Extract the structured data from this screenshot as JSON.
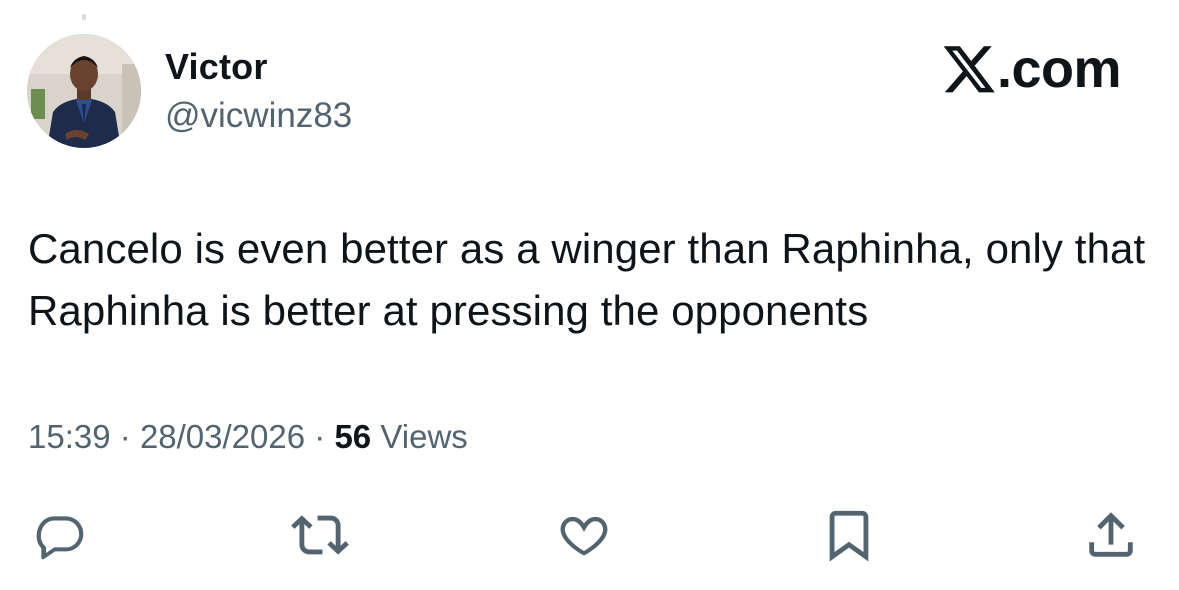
{
  "author": {
    "display_name": "Victor",
    "handle": "@vicwinz83"
  },
  "brand": {
    "text": ".com",
    "logo_icon": "x-logo-icon"
  },
  "tweet": {
    "text": "Cancelo is even better as a winger than Raphinha, only that Raphinha is better at pressing the opponents",
    "time": "15:39",
    "separator": "·",
    "date": "28/03/2026",
    "view_count": "56",
    "views_label": "Views"
  },
  "actions": [
    {
      "name": "reply",
      "icon": "reply-icon"
    },
    {
      "name": "retweet",
      "icon": "retweet-icon"
    },
    {
      "name": "like",
      "icon": "heart-icon"
    },
    {
      "name": "bookmark",
      "icon": "bookmark-icon"
    },
    {
      "name": "share",
      "icon": "share-icon"
    }
  ],
  "colors": {
    "text": "#0f1419",
    "secondary": "#536471",
    "icon": "#536471"
  }
}
